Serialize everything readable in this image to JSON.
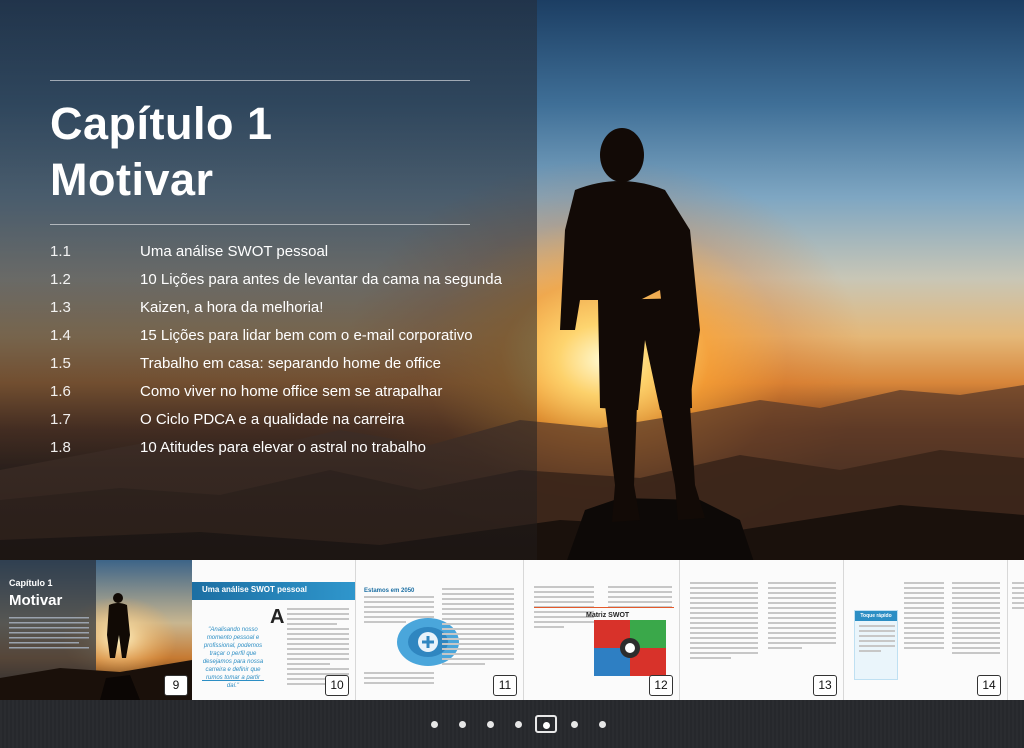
{
  "chapter": {
    "title_line1": "Capítulo 1",
    "title_line2": "Motivar"
  },
  "toc": [
    {
      "num": "1.1",
      "title": "Uma análise SWOT pessoal"
    },
    {
      "num": "1.2",
      "title": "10 Lições para antes de levantar da cama na segunda"
    },
    {
      "num": "1.3",
      "title": "Kaizen, a hora da melhoria!"
    },
    {
      "num": "1.4",
      "title": "15 Lições para lidar bem com o e-mail corporativo"
    },
    {
      "num": "1.5",
      "title": "Trabalho em casa: separando home de office"
    },
    {
      "num": "1.6",
      "title": "Como viver no home office sem se atrapalhar"
    },
    {
      "num": "1.7",
      "title": "O Ciclo PDCA e a qualidade na carreira"
    },
    {
      "num": "1.8",
      "title": "10 Atitudes para elevar o astral no trabalho"
    }
  ],
  "thumbnails": {
    "p9": {
      "page": "9",
      "line1": "Capítulo 1",
      "line2": "Motivar"
    },
    "p10": {
      "page": "10",
      "header": "Uma análise SWOT pessoal",
      "quote": "\"Analisando nosso momento pessoal e profissional, podemos traçar o perfil que desejamos para nossa carreira e definir que rumos tomar a partir daí.\""
    },
    "p11": {
      "page": "11",
      "heading": "Estamos em 2050"
    },
    "p12": {
      "page": "12",
      "figure_title": "Matriz SWOT"
    },
    "p13": {
      "page": "13"
    },
    "p14": {
      "page": "14",
      "box_title": "Toque rápido"
    }
  },
  "pagination": {
    "total": 7,
    "current": 5
  },
  "colors": {
    "accent_blue": "#2c8ec4",
    "panel_text": "#ffffff"
  }
}
